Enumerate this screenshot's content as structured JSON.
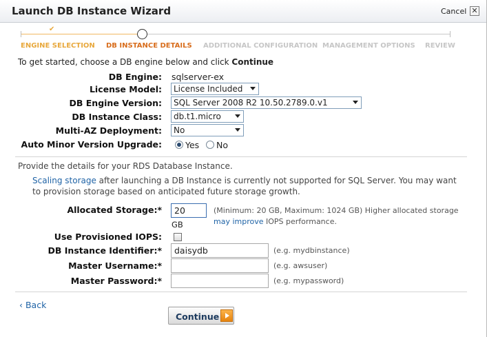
{
  "window": {
    "title": "Launch DB Instance Wizard",
    "cancel_label": "Cancel",
    "close_glyph": "✕"
  },
  "steps": [
    {
      "label": "ENGINE SELECTION",
      "state": "done"
    },
    {
      "label": "DB INSTANCE DETAILS",
      "state": "active"
    },
    {
      "label": "ADDITIONAL CONFIGURATION",
      "state": "todo"
    },
    {
      "label": "MANAGEMENT OPTIONS",
      "state": "todo"
    },
    {
      "label": "REVIEW",
      "state": "todo"
    }
  ],
  "intro": {
    "text": "To get started, choose a DB engine below and click ",
    "emphasis": "Continue"
  },
  "form": {
    "db_engine": {
      "label": "DB Engine:",
      "value": "sqlserver-ex"
    },
    "license_model": {
      "label": "License Model:",
      "value": "License Included"
    },
    "engine_version": {
      "label": "DB Engine Version:",
      "value": "SQL Server 2008 R2 10.50.2789.0.v1"
    },
    "instance_class": {
      "label": "DB Instance Class:",
      "value": "db.t1.micro"
    },
    "multi_az": {
      "label": "Multi-AZ Deployment:",
      "value": "No"
    },
    "auto_minor": {
      "label": "Auto Minor Version Upgrade:",
      "yes_label": "Yes",
      "no_label": "No",
      "selected": "Yes"
    }
  },
  "details": {
    "heading": "Provide the details for your RDS Database Instance.",
    "note_link": "Scaling storage",
    "note_text": " after launching a DB Instance is currently not supported for SQL Server. You may want to provision storage based on anticipated future storage growth.",
    "allocated_storage": {
      "label": "Allocated Storage:*",
      "value": "20",
      "unit": "GB",
      "hint_before": "(Minimum: 20 GB, Maximum: 1024 GB) Higher allocated storage ",
      "hint_link": "may improve",
      "hint_after": " IOPS performance."
    },
    "provisioned_iops": {
      "label": "Use Provisioned IOPS:",
      "checked": false
    },
    "instance_identifier": {
      "label": "DB Instance Identifier:*",
      "value": "daisydb",
      "hint": "(e.g. mydbinstance)"
    },
    "master_username": {
      "label": "Master Username:*",
      "value": "",
      "hint": "(e.g. awsuser)"
    },
    "master_password": {
      "label": "Master Password:*",
      "value": "",
      "hint": "(e.g. mypassword)"
    }
  },
  "footer": {
    "back_label": "Back",
    "back_glyph": "‹",
    "continue_label": "Continue"
  },
  "colors": {
    "accent": "#e8a83c",
    "active": "#d86d1c",
    "link": "#1f63a6"
  }
}
